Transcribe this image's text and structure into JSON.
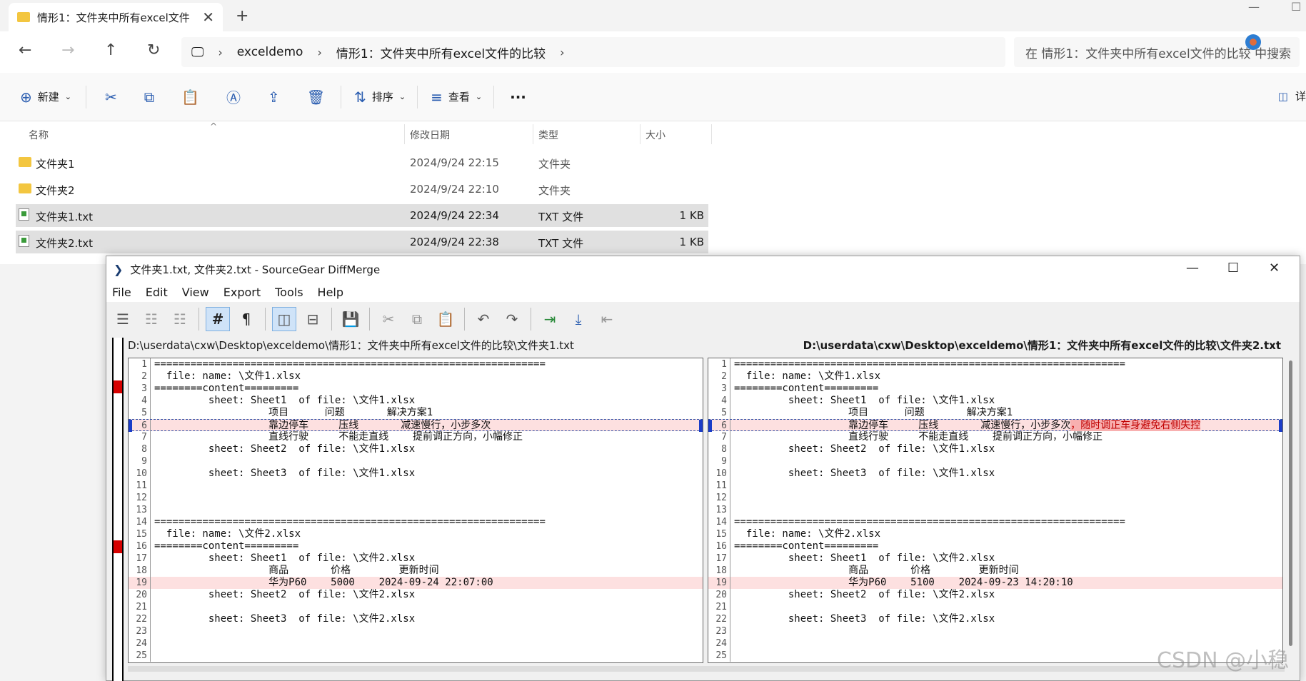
{
  "explorer": {
    "tab_title": "情形1：文件夹中所有excel文件",
    "tab_close": "✕",
    "new_tab": "+",
    "breadcrumb": [
      "exceldemo",
      "情形1：文件夹中所有excel文件的比较"
    ],
    "search_placeholder": "在 情形1：文件夹中所有excel文件的比较 中搜索",
    "commands": {
      "new": "新建",
      "sort": "排序",
      "view": "查看",
      "more": "···",
      "details": "详"
    },
    "columns": [
      "名称",
      "修改日期",
      "类型",
      "大小"
    ],
    "files": [
      {
        "name": "文件夹1",
        "date": "2024/9/24 22:15",
        "type": "文件夹",
        "size": "",
        "kind": "folder"
      },
      {
        "name": "文件夹2",
        "date": "2024/9/24 22:10",
        "type": "文件夹",
        "size": "",
        "kind": "folder"
      },
      {
        "name": "文件夹1.txt",
        "date": "2024/9/24 22:34",
        "type": "TXT 文件",
        "size": "1 KB",
        "kind": "txt"
      },
      {
        "name": "文件夹2.txt",
        "date": "2024/9/24 22:38",
        "type": "TXT 文件",
        "size": "1 KB",
        "kind": "txt"
      }
    ]
  },
  "diffmerge": {
    "title": "文件夹1.txt, 文件夹2.txt - SourceGear DiffMerge",
    "menu": [
      "File",
      "Edit",
      "View",
      "Export",
      "Tools",
      "Help"
    ],
    "left_path": "D:\\userdata\\cxw\\Desktop\\exceldemo\\情形1：文件夹中所有excel文件的比较\\文件夹1.txt",
    "right_path": "D:\\userdata\\cxw\\Desktop\\exceldemo\\情形1：文件夹中所有excel文件的比较\\文件夹2.txt",
    "left_lines": [
      "=================================================================",
      "  file: name: \\文件1.xlsx",
      "========content=========",
      "         sheet: Sheet1  of file: \\文件1.xlsx",
      "                   项目      问题       解决方案1",
      "                   靠边停车     压线       减速慢行，小步多次",
      "                   直线行驶     不能走直线    提前调正方向，小幅修正",
      "         sheet: Sheet2  of file: \\文件1.xlsx",
      "",
      "         sheet: Sheet3  of file: \\文件1.xlsx",
      "",
      "",
      "",
      "=================================================================",
      "  file: name: \\文件2.xlsx",
      "========content=========",
      "         sheet: Sheet1  of file: \\文件2.xlsx",
      "                   商品       价格        更新时间",
      "                   华为P60    5000    2024-09-24 22:07:00",
      "         sheet: Sheet2  of file: \\文件2.xlsx",
      "",
      "         sheet: Sheet3  of file: \\文件2.xlsx",
      "",
      "",
      ""
    ],
    "right_lines": [
      "=================================================================",
      "  file: name: \\文件1.xlsx",
      "========content=========",
      "         sheet: Sheet1  of file: \\文件1.xlsx",
      "                   项目      问题       解决方案1",
      "                   靠边停车     压线       减速慢行，小步多次",
      "                   直线行驶     不能走直线    提前调正方向，小幅修正",
      "         sheet: Sheet2  of file: \\文件1.xlsx",
      "",
      "         sheet: Sheet3  of file: \\文件1.xlsx",
      "",
      "",
      "",
      "=================================================================",
      "  file: name: \\文件2.xlsx",
      "========content=========",
      "         sheet: Sheet1  of file: \\文件2.xlsx",
      "                   商品       价格        更新时间",
      "                   华为P60    5100    2024-09-23 14:20:10",
      "         sheet: Sheet2  of file: \\文件2.xlsx",
      "",
      "         sheet: Sheet3  of file: \\文件2.xlsx",
      "",
      "",
      ""
    ],
    "right_line6_extra": "，随时调正车身避免右侧失控",
    "diff_lines": [
      6,
      19
    ]
  },
  "watermark": "CSDN @小稳"
}
